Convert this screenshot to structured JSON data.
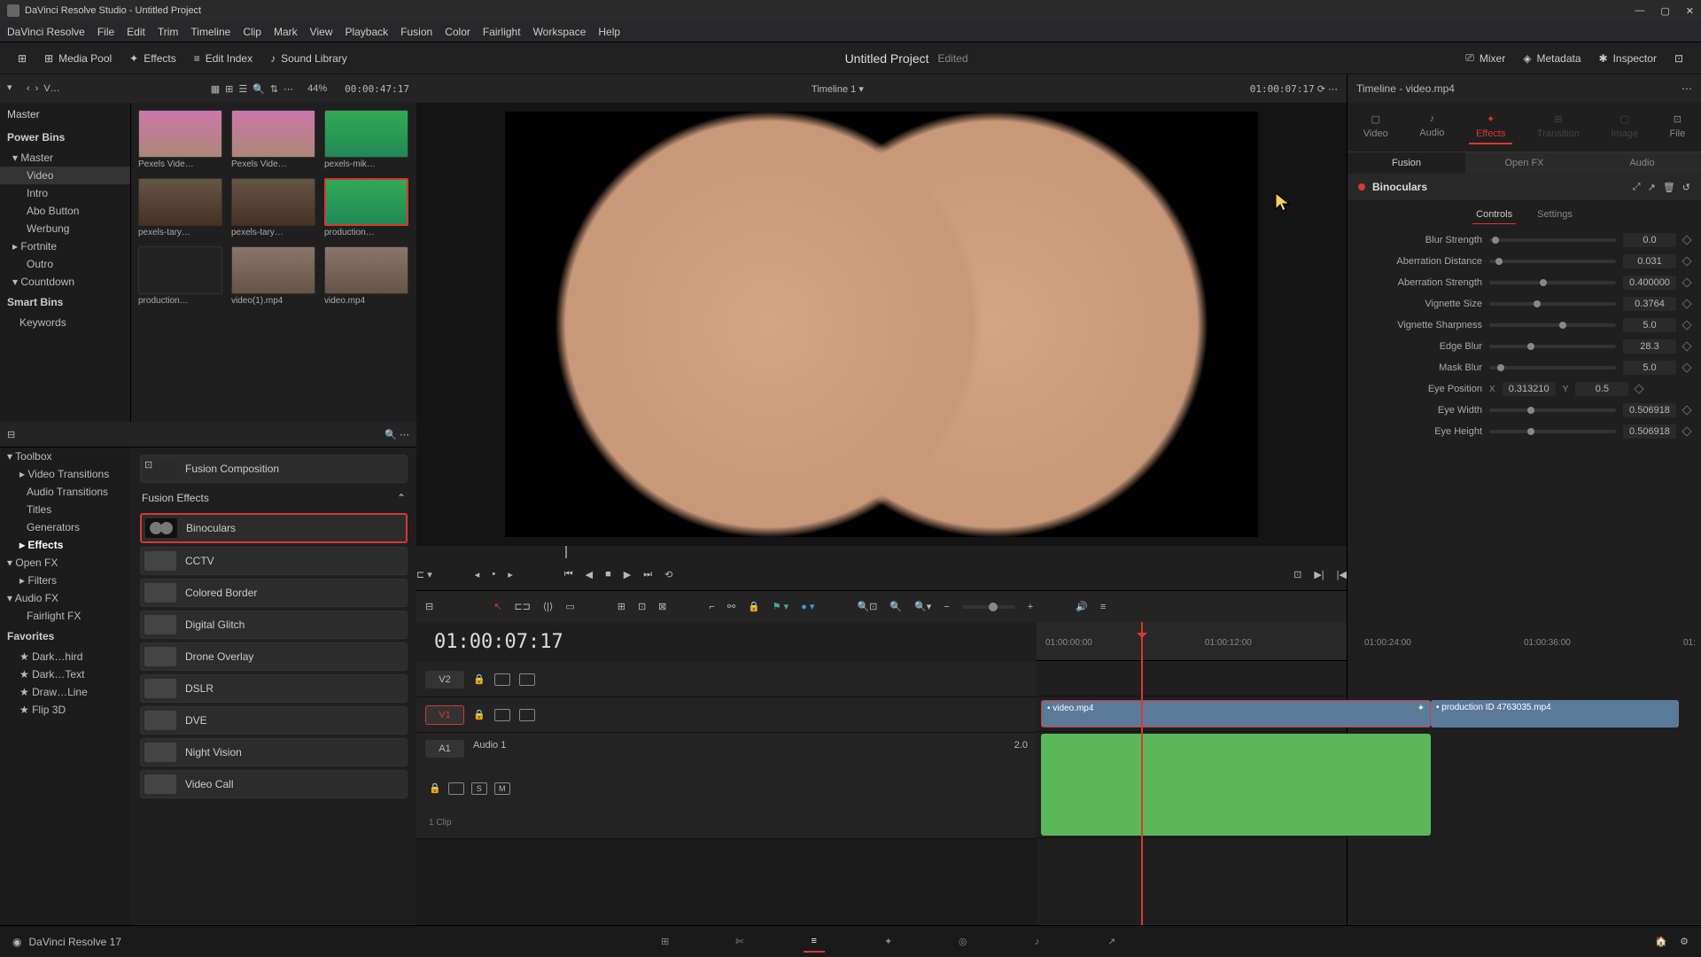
{
  "titlebar": {
    "title": "DaVinci Resolve Studio - Untitled Project"
  },
  "menu": [
    "DaVinci Resolve",
    "File",
    "Edit",
    "Trim",
    "Timeline",
    "Clip",
    "Mark",
    "View",
    "Playback",
    "Fusion",
    "Color",
    "Fairlight",
    "Workspace",
    "Help"
  ],
  "toolbar": {
    "media_pool": "Media Pool",
    "effects": "Effects",
    "edit_index": "Edit Index",
    "sound_library": "Sound Library",
    "project": "Untitled Project",
    "project_status": "Edited",
    "mixer": "Mixer",
    "metadata": "Metadata",
    "inspector": "Inspector"
  },
  "media_top": {
    "path": "V…",
    "zoom": "44%",
    "source_tc": "00:00:47:17"
  },
  "bins": {
    "master": "Master",
    "power_bins": "Power Bins",
    "power_items": [
      "Master",
      "Video",
      "Intro",
      "Abo Button",
      "Werbung",
      "Fortnite",
      "Outro",
      "Countdown"
    ],
    "smart_bins": "Smart Bins",
    "smart_items": [
      "Keywords"
    ]
  },
  "clips": [
    {
      "name": "Pexels Vide…",
      "cls": "thumb-beach"
    },
    {
      "name": "Pexels Vide…",
      "cls": "thumb-beach"
    },
    {
      "name": "pexels-mik…",
      "cls": "thumb-green"
    },
    {
      "name": "pexels-tary…",
      "cls": "thumb-wood"
    },
    {
      "name": "pexels-tary…",
      "cls": "thumb-wood"
    },
    {
      "name": "production…",
      "cls": "thumb-green",
      "sel": true
    },
    {
      "name": "production…",
      "cls": "thumb-dark"
    },
    {
      "name": "video(1).mp4",
      "cls": "thumb-face"
    },
    {
      "name": "video.mp4",
      "cls": "thumb-face"
    }
  ],
  "fx_tree": {
    "toolbox": "Toolbox",
    "items": [
      "Video Transitions",
      "Audio Transitions",
      "Titles",
      "Generators",
      "Effects"
    ],
    "openfx": "Open FX",
    "filters": "Filters",
    "audiofx": "Audio FX",
    "fairlight": "Fairlight FX",
    "favorites": "Favorites",
    "fav_items": [
      "Dark…hird",
      "Dark…Text",
      "Draw…Line",
      "Flip 3D"
    ]
  },
  "fx_top": {
    "fusion_comp": "Fusion Composition",
    "cat": "Fusion Effects"
  },
  "fx_list": [
    {
      "name": "Binoculars",
      "sel": true,
      "cls": "bino-thumb"
    },
    {
      "name": "CCTV"
    },
    {
      "name": "Colored Border"
    },
    {
      "name": "Digital Glitch"
    },
    {
      "name": "Drone Overlay"
    },
    {
      "name": "DSLR"
    },
    {
      "name": "DVE"
    },
    {
      "name": "Night Vision"
    },
    {
      "name": "Video Call"
    }
  ],
  "viewer": {
    "timeline_name": "Timeline 1",
    "record_tc": "01:00:07:17"
  },
  "timeline": {
    "tc": "01:00:07:17",
    "ruler": [
      "01:00:00:00",
      "01:00:12:00",
      "01:00:24:00",
      "01:00:36:00",
      "01:"
    ],
    "v2": "V2",
    "v1": "V1",
    "a1": "A1",
    "a1_name": "Audio 1",
    "a1_ch": "2.0",
    "a1_sub": "1 Clip",
    "clip1": "video.mp4",
    "clip2": "production ID 4763035.mp4"
  },
  "inspector": {
    "title": "Timeline - video.mp4",
    "tabs": {
      "video": "Video",
      "audio": "Audio",
      "effects": "Effects",
      "transition": "Transition",
      "image": "Image",
      "file": "File"
    },
    "sub": {
      "fusion": "Fusion",
      "openfx": "Open FX",
      "audio": "Audio"
    },
    "fx_name": "Binoculars",
    "ctabs": {
      "controls": "Controls",
      "settings": "Settings"
    },
    "params": [
      {
        "label": "Blur Strength",
        "val": "0.0",
        "pos": 2
      },
      {
        "label": "Aberration Distance",
        "val": "0.031",
        "pos": 5
      },
      {
        "label": "Aberration Strength",
        "val": "0.400000",
        "pos": 40
      },
      {
        "label": "Vignette Size",
        "val": "0.3764",
        "pos": 35
      },
      {
        "label": "Vignette Sharpness",
        "val": "5.0",
        "pos": 55
      },
      {
        "label": "Edge Blur",
        "val": "28.3",
        "pos": 30
      },
      {
        "label": "Mask Blur",
        "val": "5.0",
        "pos": 6
      },
      {
        "label": "Eye Position",
        "val": "0.313210",
        "xy": true,
        "yval": "0.5"
      },
      {
        "label": "Eye Width",
        "val": "0.506918",
        "pos": 30
      },
      {
        "label": "Eye Height",
        "val": "0.506918",
        "pos": 30
      }
    ]
  },
  "bottom": {
    "app": "DaVinci Resolve 17"
  }
}
